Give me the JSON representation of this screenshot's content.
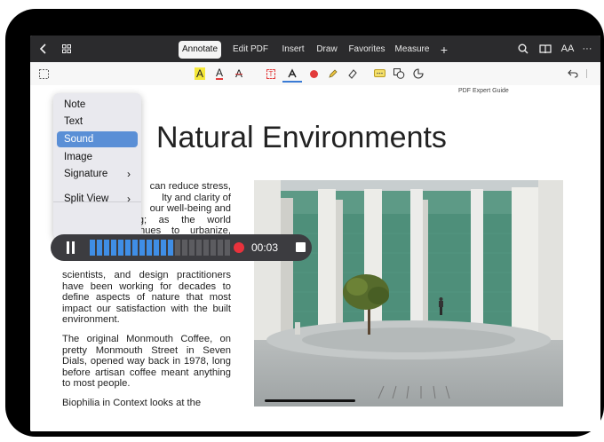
{
  "topbar": {
    "tabs": [
      {
        "label": "Annotate",
        "active": true
      },
      {
        "label": "Edit PDF",
        "active": false
      },
      {
        "label": "Insert",
        "active": false
      },
      {
        "label": "Draw",
        "active": false
      },
      {
        "label": "Favorites",
        "active": false
      },
      {
        "label": "Measure",
        "active": false
      }
    ],
    "add_tab_label": "+",
    "text_size_label": "AA",
    "more_label": "···"
  },
  "toolbar": {
    "highlight_label": "A",
    "underline_label": "A",
    "strike_label": "A",
    "text_box_label": "T",
    "colors": {
      "highlight": "#f5e83a",
      "red": "#e23b3b",
      "accent": "#3a7bd5"
    }
  },
  "document": {
    "name": "PDF Expert Guide",
    "title": "Natural Environments",
    "para1_lines": [
      "can reduce stress,",
      "lty and clarity of",
      "our well-being and",
      "expedite healing; as the world",
      "population continues to urbanize,"
    ],
    "para1_tail": "scientists, and design practitioners have been working for decades to define aspects of nature that most impact our satisfaction with the built environment.",
    "para2": "The original Monmouth Coffee, on pretty Monmouth Street in Seven Dials, opened way back in 1978, long before artisan coffee meant anything to most people.",
    "para3": "Biophilia in Context looks at the"
  },
  "menu": {
    "items": [
      {
        "label": "Note",
        "selected": false,
        "submenu": false
      },
      {
        "label": "Text",
        "selected": false,
        "submenu": false
      },
      {
        "label": "Sound",
        "selected": true,
        "submenu": false
      },
      {
        "label": "Image",
        "selected": false,
        "submenu": false
      },
      {
        "label": "Signature",
        "selected": false,
        "submenu": true
      },
      {
        "label": "Split View",
        "selected": false,
        "submenu": true
      }
    ],
    "chevron": "›"
  },
  "recorder": {
    "elapsed": "00:03",
    "levels_filled": 12,
    "levels_total": 20,
    "colors": {
      "active": "#3f8ee6",
      "inactive": "#5c5c60"
    }
  }
}
